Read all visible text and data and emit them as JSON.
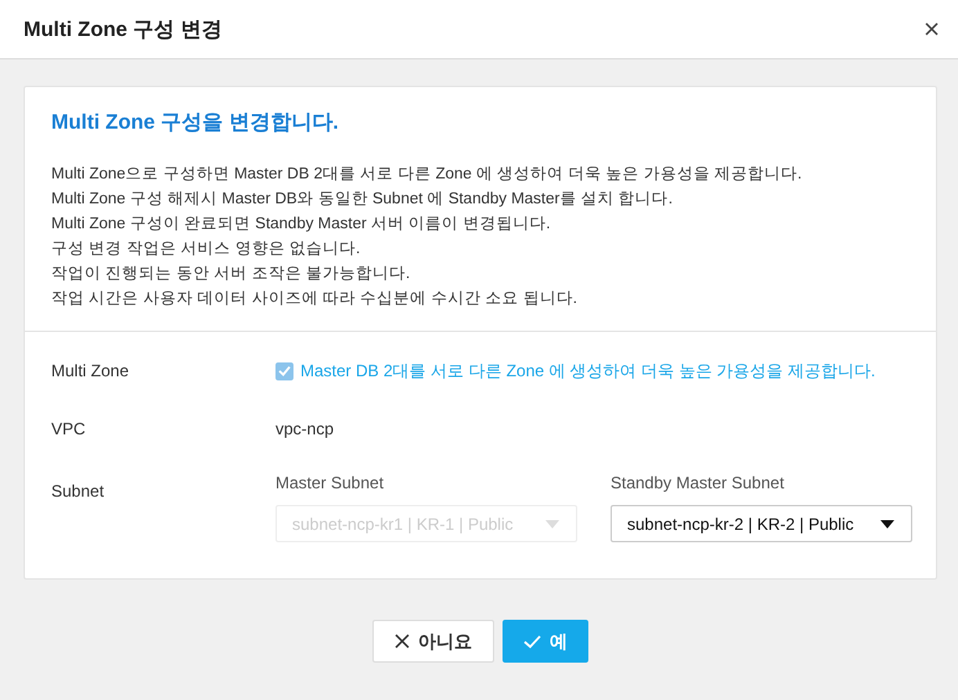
{
  "window": {
    "title": "Multi Zone 구성 변경"
  },
  "notice": {
    "heading": "Multi Zone 구성을 변경합니다.",
    "lines": [
      "Multi Zone으로 구성하면 Master DB 2대를 서로 다른 Zone 에 생성하여 더욱 높은 가용성을 제공합니다.",
      "Multi Zone 구성 해제시 Master DB와 동일한 Subnet 에 Standby Master를 설치 합니다.",
      "Multi Zone 구성이 완료되면 Standby Master 서버 이름이 변경됩니다.",
      "구성 변경 작업은 서비스 영향은 없습니다.",
      "작업이 진행되는 동안 서버 조작은 불가능합니다.",
      "작업 시간은 사용자 데이터 사이즈에 따라 수십분에 수시간 소요 됩니다."
    ]
  },
  "form": {
    "multi_zone": {
      "label": "Multi Zone",
      "checkbox_label": "Master DB 2대를 서로 다른 Zone 에 생성하여 더욱 높은 가용성을 제공합니다.",
      "checked": true
    },
    "vpc": {
      "label": "VPC",
      "value": "vpc-ncp"
    },
    "subnet": {
      "label": "Subnet",
      "selects": [
        {
          "label": "Master Subnet",
          "value": "subnet-ncp-kr1 | KR-1 | Public",
          "disabled": true
        },
        {
          "label": "Standby Master Subnet",
          "value": "subnet-ncp-kr-2 | KR-2 | Public",
          "disabled": false
        }
      ]
    }
  },
  "buttons": [
    {
      "label": "아니요",
      "kind": "cancel"
    },
    {
      "label": "예",
      "kind": "confirm"
    }
  ]
}
